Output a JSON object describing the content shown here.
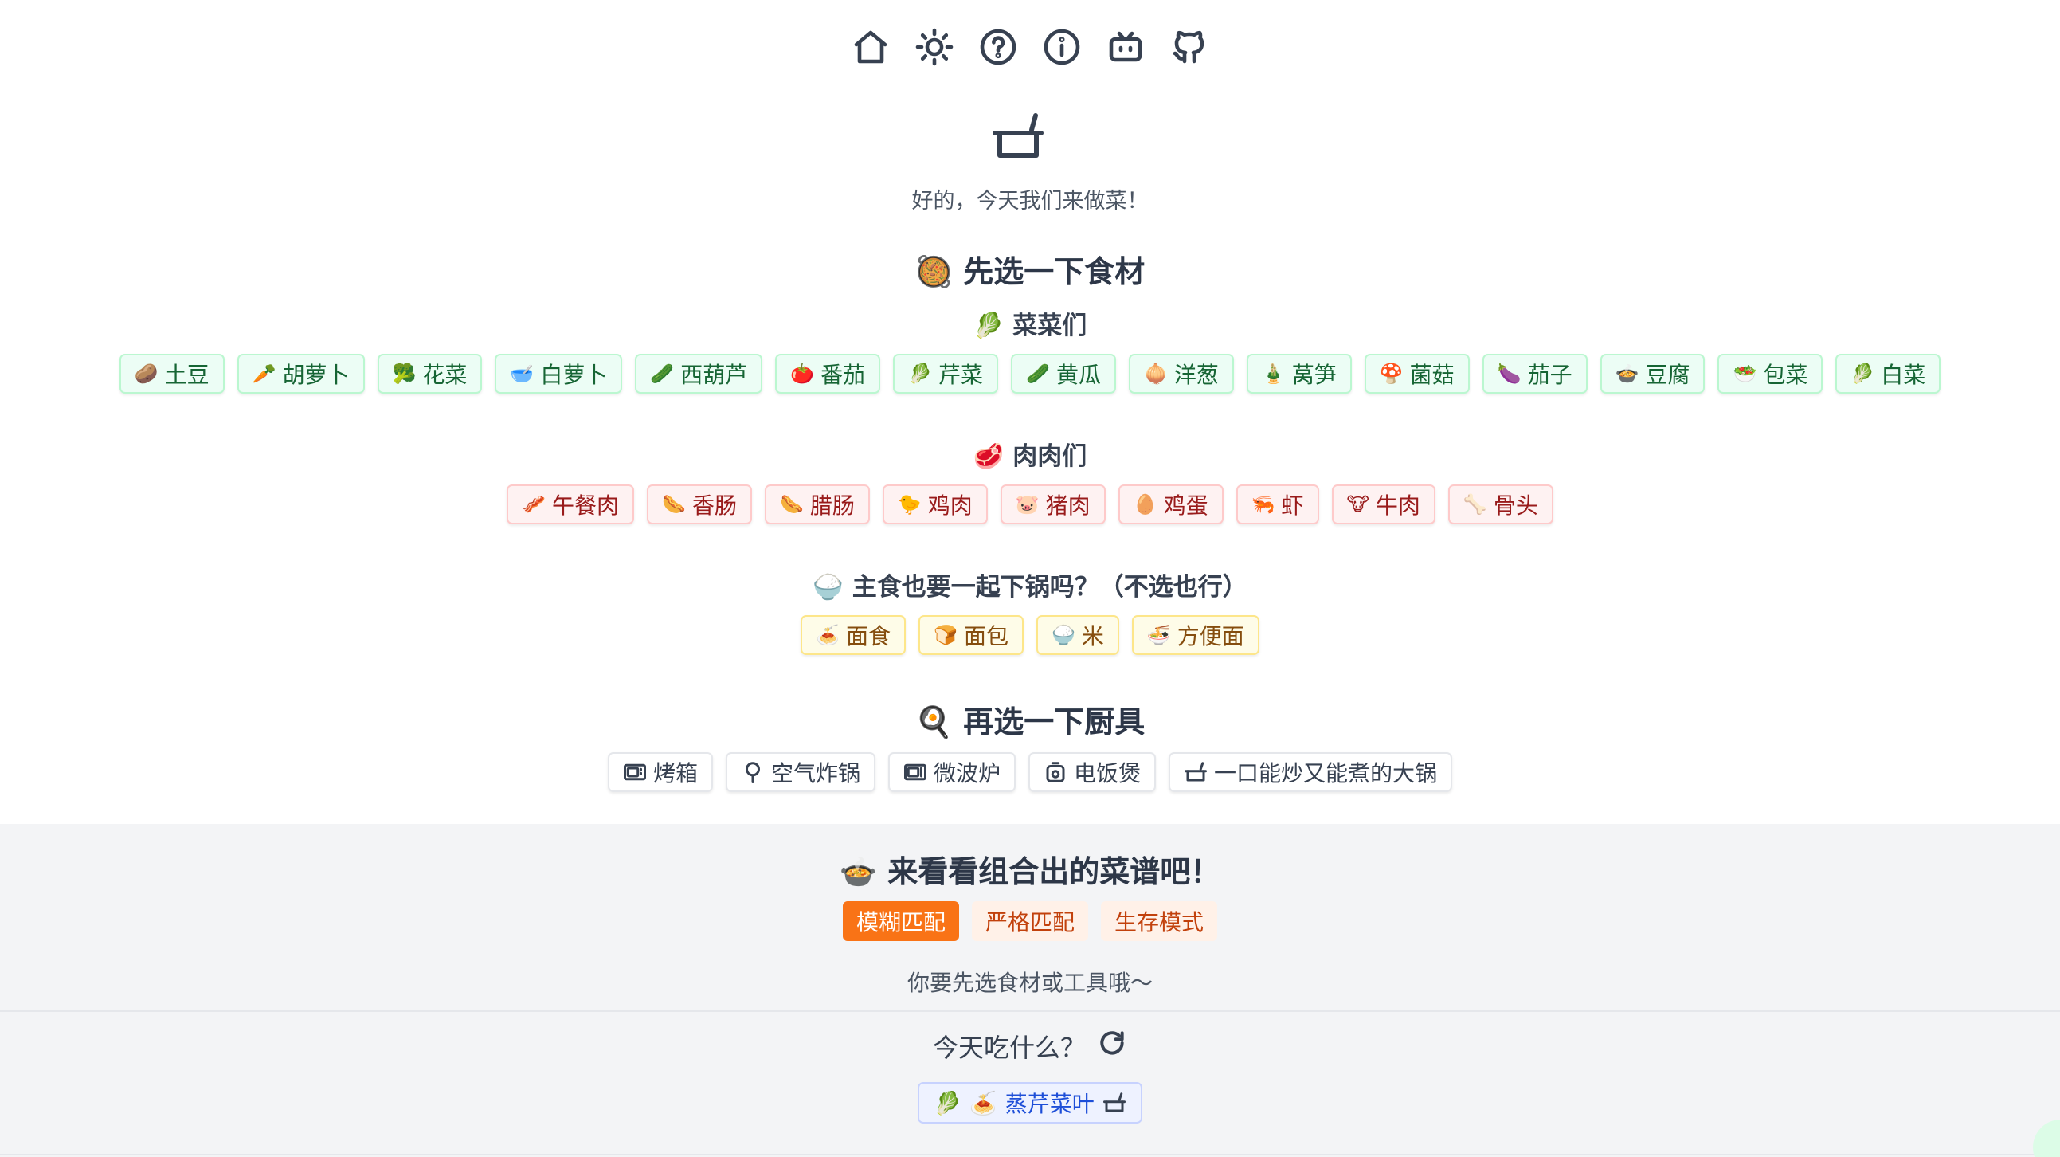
{
  "nav": [
    {
      "name": "home-icon"
    },
    {
      "name": "sun-icon"
    },
    {
      "name": "help-icon"
    },
    {
      "name": "info-icon"
    },
    {
      "name": "bilibili-icon"
    },
    {
      "name": "github-icon"
    }
  ],
  "header": {
    "logo_icon": "pot-icon",
    "tagline": "好的，今天我们来做菜！"
  },
  "ingredients": {
    "title": "先选一下食材",
    "title_emoji": "🥘",
    "vegetables": {
      "title": "菜菜们",
      "emoji": "🥬",
      "items": [
        {
          "emoji": "🥔",
          "label": "土豆"
        },
        {
          "emoji": "🥕",
          "label": "胡萝卜"
        },
        {
          "emoji": "🥦",
          "label": "花菜"
        },
        {
          "emoji": "🥣",
          "label": "白萝卜"
        },
        {
          "emoji": "🥒",
          "label": "西葫芦"
        },
        {
          "emoji": "🍅",
          "label": "番茄"
        },
        {
          "emoji": "🥬",
          "label": "芹菜"
        },
        {
          "emoji": "🥒",
          "label": "黄瓜"
        },
        {
          "emoji": "🧅",
          "label": "洋葱"
        },
        {
          "emoji": "🎍",
          "label": "莴笋"
        },
        {
          "emoji": "🍄",
          "label": "菌菇"
        },
        {
          "emoji": "🍆",
          "label": "茄子"
        },
        {
          "emoji": "🍲",
          "label": "豆腐"
        },
        {
          "emoji": "🥗",
          "label": "包菜"
        },
        {
          "emoji": "🥬",
          "label": "白菜"
        }
      ]
    },
    "meats": {
      "title": "肉肉们",
      "emoji": "🥩",
      "items": [
        {
          "emoji": "🥓",
          "label": "午餐肉"
        },
        {
          "emoji": "🌭",
          "label": "香肠"
        },
        {
          "emoji": "🌭",
          "label": "腊肠"
        },
        {
          "emoji": "🐤",
          "label": "鸡肉"
        },
        {
          "emoji": "🐷",
          "label": "猪肉"
        },
        {
          "emoji": "🥚",
          "label": "鸡蛋"
        },
        {
          "emoji": "🦐",
          "label": "虾"
        },
        {
          "emoji": "🐮",
          "label": "牛肉"
        },
        {
          "emoji": "🦴",
          "label": "骨头"
        }
      ]
    },
    "staples": {
      "title": "主食也要一起下锅吗？（不选也行）",
      "emoji": "🍚",
      "items": [
        {
          "emoji": "🍝",
          "label": "面食"
        },
        {
          "emoji": "🍞",
          "label": "面包"
        },
        {
          "emoji": "🍚",
          "label": "米"
        },
        {
          "emoji": "🍜",
          "label": "方便面"
        }
      ]
    }
  },
  "tools": {
    "title": "再选一下厨具",
    "title_emoji": "🍳",
    "items": [
      {
        "icon": "oven-icon",
        "label": "烤箱"
      },
      {
        "icon": "air-fryer-icon",
        "label": "空气炸锅"
      },
      {
        "icon": "microwave-icon",
        "label": "微波炉"
      },
      {
        "icon": "rice-cooker-icon",
        "label": "电饭煲"
      },
      {
        "icon": "pot-icon",
        "label": "一口能炒又能煮的大锅"
      }
    ]
  },
  "results": {
    "title": "来看看组合出的菜谱吧！",
    "title_emoji": "🍲",
    "modes": [
      {
        "label": "模糊匹配",
        "active": true
      },
      {
        "label": "严格匹配",
        "active": false
      },
      {
        "label": "生存模式",
        "active": false
      }
    ],
    "hint": "你要先选食材或工具哦～",
    "today_label": "今天吃什么？",
    "dish": {
      "emoji1": "🥬",
      "emoji2": "🍝",
      "label": "蒸芹菜叶",
      "icon": "pot-icon"
    }
  },
  "colors": {
    "accent": "#f97316",
    "veg_bg": "#ecfdf5",
    "meat_bg": "#fef2f2",
    "staple_bg": "#fefce8",
    "result_bg": "#f3f4f6"
  }
}
